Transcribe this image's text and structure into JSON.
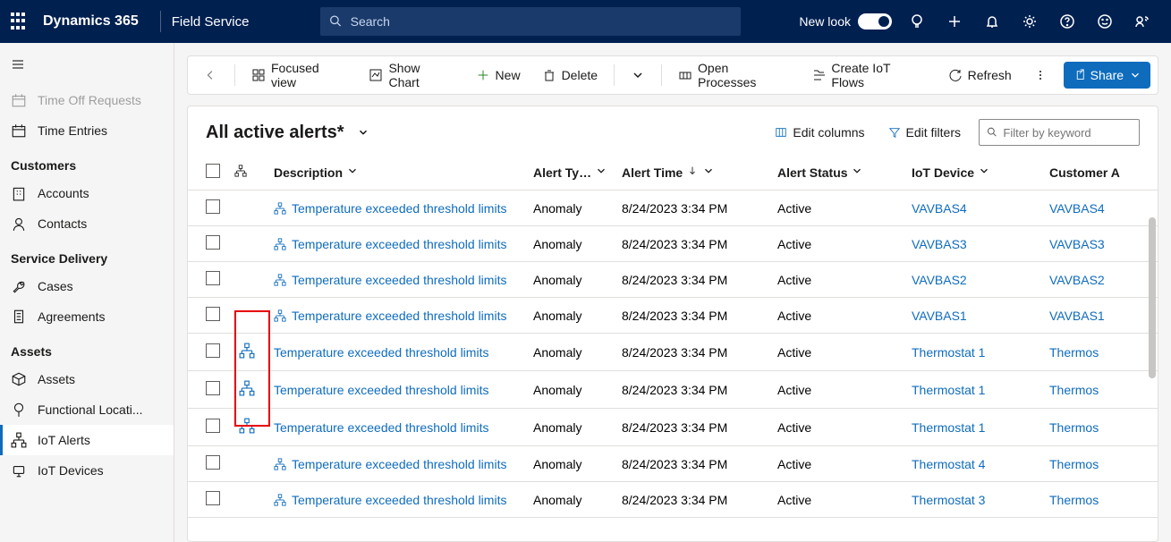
{
  "header": {
    "brand": "Dynamics 365",
    "app": "Field Service",
    "search_placeholder": "Search",
    "newlook": "New look"
  },
  "sidebar": {
    "loose_items": [
      {
        "icon": "request",
        "label": "Time Off Requests",
        "faded": true
      },
      {
        "icon": "calendar",
        "label": "Time Entries"
      }
    ],
    "groups": [
      {
        "heading": "Customers",
        "items": [
          {
            "icon": "building",
            "label": "Accounts"
          },
          {
            "icon": "person",
            "label": "Contacts"
          }
        ]
      },
      {
        "heading": "Service Delivery",
        "items": [
          {
            "icon": "wrench",
            "label": "Cases"
          },
          {
            "icon": "doc",
            "label": "Agreements"
          }
        ]
      },
      {
        "heading": "Assets",
        "items": [
          {
            "icon": "cube",
            "label": "Assets"
          },
          {
            "icon": "pin",
            "label": "Functional Locati..."
          },
          {
            "icon": "hierarchy",
            "label": "IoT Alerts",
            "selected": true
          },
          {
            "icon": "device",
            "label": "IoT Devices"
          }
        ]
      }
    ]
  },
  "commandbar": {
    "focused": "Focused view",
    "showchart": "Show Chart",
    "new": "New",
    "delete": "Delete",
    "openproc": "Open Processes",
    "createflow": "Create IoT Flows",
    "refresh": "Refresh",
    "share": "Share"
  },
  "content_header": {
    "title": "All active alerts*",
    "editcols": "Edit columns",
    "editfilters": "Edit filters",
    "filter_placeholder": "Filter by keyword"
  },
  "table": {
    "columns": {
      "description": "Description",
      "alert_type": "Alert Ty…",
      "alert_time": "Alert Time",
      "alert_status": "Alert Status",
      "iot_device": "IoT Device",
      "customer": "Customer A"
    },
    "rows": [
      {
        "hier_big": false,
        "hier_small": true,
        "desc": "Temperature exceeded threshold limits",
        "type": "Anomaly",
        "time": "8/24/2023 3:34 PM",
        "status": "Active",
        "device": "VAVBAS4",
        "customer": "VAVBAS4"
      },
      {
        "hier_big": false,
        "hier_small": true,
        "desc": "Temperature exceeded threshold limits",
        "type": "Anomaly",
        "time": "8/24/2023 3:34 PM",
        "status": "Active",
        "device": "VAVBAS3",
        "customer": "VAVBAS3"
      },
      {
        "hier_big": false,
        "hier_small": true,
        "desc": "Temperature exceeded threshold limits",
        "type": "Anomaly",
        "time": "8/24/2023 3:34 PM",
        "status": "Active",
        "device": "VAVBAS2",
        "customer": "VAVBAS2"
      },
      {
        "hier_big": false,
        "hier_small": true,
        "desc": "Temperature exceeded threshold limits",
        "type": "Anomaly",
        "time": "8/24/2023 3:34 PM",
        "status": "Active",
        "device": "VAVBAS1",
        "customer": "VAVBAS1"
      },
      {
        "hier_big": true,
        "hier_small": false,
        "desc": "Temperature exceeded threshold limits",
        "type": "Anomaly",
        "time": "8/24/2023 3:34 PM",
        "status": "Active",
        "device": "Thermostat 1",
        "customer": "Thermos"
      },
      {
        "hier_big": true,
        "hier_small": false,
        "desc": "Temperature exceeded threshold limits",
        "type": "Anomaly",
        "time": "8/24/2023 3:34 PM",
        "status": "Active",
        "device": "Thermostat 1",
        "customer": "Thermos"
      },
      {
        "hier_big": true,
        "hier_small": false,
        "desc": "Temperature exceeded threshold limits",
        "type": "Anomaly",
        "time": "8/24/2023 3:34 PM",
        "status": "Active",
        "device": "Thermostat 1",
        "customer": "Thermos"
      },
      {
        "hier_big": false,
        "hier_small": true,
        "desc": "Temperature exceeded threshold limits",
        "type": "Anomaly",
        "time": "8/24/2023 3:34 PM",
        "status": "Active",
        "device": "Thermostat 4",
        "customer": "Thermos"
      },
      {
        "hier_big": false,
        "hier_small": true,
        "desc": "Temperature exceeded threshold limits",
        "type": "Anomaly",
        "time": "8/24/2023 3:34 PM",
        "status": "Active",
        "device": "Thermostat 3",
        "customer": "Thermos"
      }
    ]
  }
}
